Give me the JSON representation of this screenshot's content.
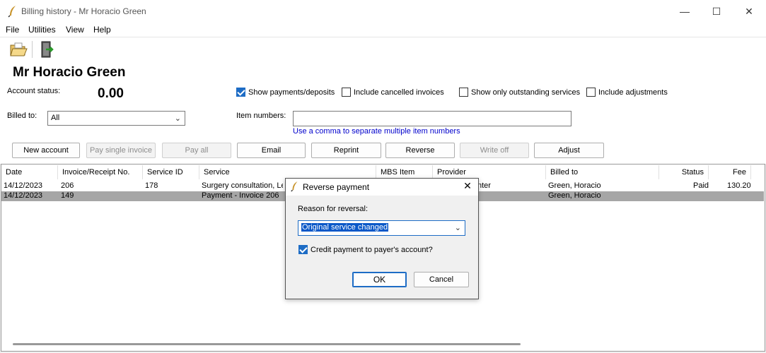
{
  "window": {
    "title": "Billing history - Mr Horacio Green",
    "minimize": "—",
    "maximize": "☐",
    "close": "✕"
  },
  "menu": {
    "items": [
      "File",
      "Utilities",
      "View",
      "Help"
    ]
  },
  "toolbar": {
    "open_icon": "folder-open-icon",
    "exit_icon": "exit-door-icon"
  },
  "patient": {
    "name": "Mr Horacio Green"
  },
  "account": {
    "status_label": "Account status:",
    "balance": "0.00"
  },
  "filters": {
    "show_payments": {
      "label": "Show payments/deposits",
      "checked": true
    },
    "include_cancelled": {
      "label": "Include cancelled invoices",
      "checked": false
    },
    "only_outstanding": {
      "label": "Show only outstanding services",
      "checked": false
    },
    "include_adjustments": {
      "label": "Include adjustments",
      "checked": false
    }
  },
  "billed_to": {
    "label": "Billed to:",
    "value": "All"
  },
  "item_numbers": {
    "label": "Item numbers:",
    "value": "",
    "hint": "Use a comma to separate multiple item numbers"
  },
  "actions": {
    "new_account": "New account",
    "pay_single": "Pay single invoice",
    "pay_all": "Pay all",
    "email": "Email",
    "reprint": "Reprint",
    "reverse": "Reverse",
    "write_off": "Write off",
    "adjust": "Adjust"
  },
  "grid": {
    "columns": [
      "Date",
      "Invoice/Receipt No.",
      "Service ID",
      "Service",
      "MBS Item",
      "Provider",
      "Billed to",
      "Status",
      "Fee"
    ],
    "rows": [
      {
        "date": "14/12/2023",
        "invoice": "206",
        "service_id": "178",
        "service": "Surgery consultation, Lev",
        "provider": "nter",
        "billed_to": "Green, Horacio",
        "status": "Paid",
        "fee": "130.20"
      },
      {
        "date": "14/12/2023",
        "invoice": "149",
        "service_id": "",
        "service": "Payment - Invoice 206",
        "provider": "",
        "billed_to": "Green, Horacio",
        "status": "",
        "fee": ""
      }
    ]
  },
  "dialog": {
    "title": "Reverse payment",
    "reason_label": "Reason for reversal:",
    "reason_value": "Original service changed",
    "credit_label": "Credit payment to payer's account?",
    "credit_checked": true,
    "ok": "OK",
    "cancel": "Cancel"
  },
  "colors": {
    "accent": "#1d6cc5",
    "link": "#0000cc",
    "selected_row": "#a6a6a6"
  }
}
